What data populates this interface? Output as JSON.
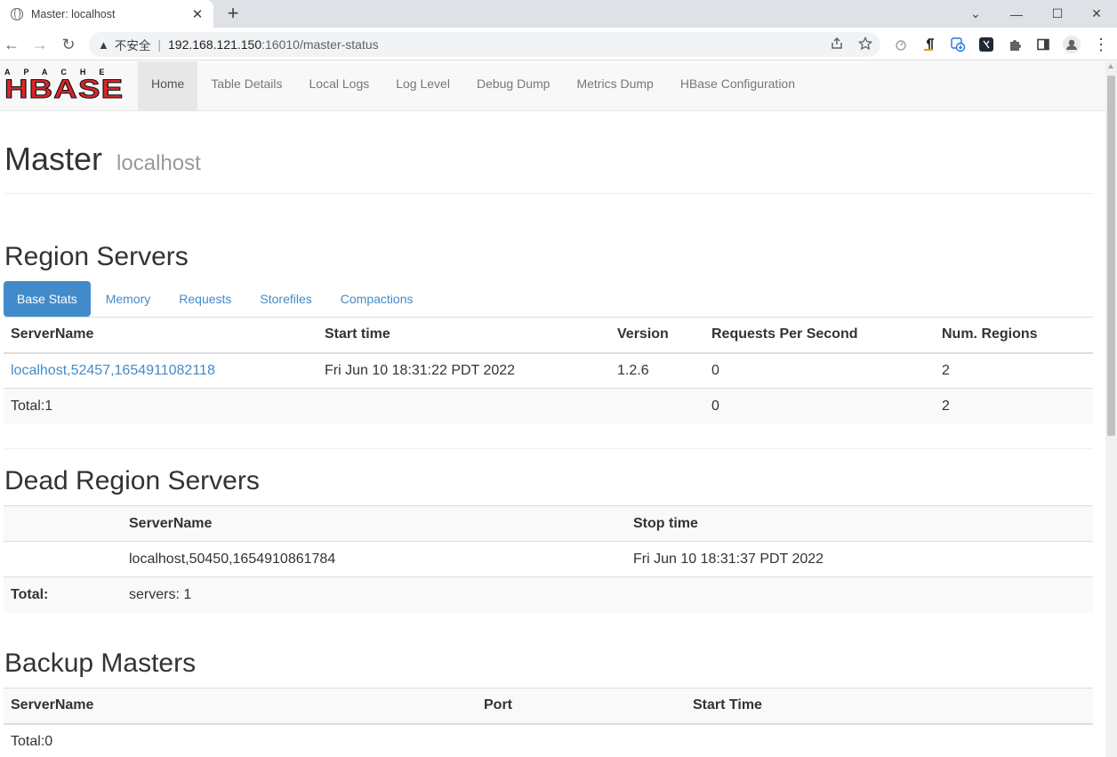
{
  "browser": {
    "tab_title": "Master: localhost",
    "close_glyph": "✕",
    "newtab_glyph": "+",
    "window_controls": [
      "⌄",
      "—",
      "☐",
      "✕"
    ],
    "nav": {
      "back": "←",
      "forward": "→",
      "reload": "↻"
    },
    "address": {
      "warning_glyph": "▲",
      "insecure_label": "不安全",
      "separator": "|",
      "host": "192.168.121.150",
      "path": ":16010/master-status"
    },
    "menu_glyph": "⋮"
  },
  "logo": {
    "top": "APACHE",
    "bottom": "HBASE"
  },
  "nav_items": [
    "Home",
    "Table Details",
    "Local Logs",
    "Log Level",
    "Debug Dump",
    "Metrics Dump",
    "HBase Configuration"
  ],
  "header": {
    "title": "Master",
    "subtitle": "localhost"
  },
  "region_servers": {
    "heading": "Region Servers",
    "tabs": [
      "Base Stats",
      "Memory",
      "Requests",
      "Storefiles",
      "Compactions"
    ],
    "columns": [
      "ServerName",
      "Start time",
      "Version",
      "Requests Per Second",
      "Num. Regions"
    ],
    "rows": [
      {
        "server": "localhost,52457,1654911082118",
        "start": "Fri Jun 10 18:31:22 PDT 2022",
        "version": "1.2.6",
        "rps": "0",
        "regions": "2"
      }
    ],
    "total": {
      "label": "Total:1",
      "rps": "0",
      "regions": "2"
    }
  },
  "dead_region_servers": {
    "heading": "Dead Region Servers",
    "columns": [
      "ServerName",
      "Stop time"
    ],
    "rows": [
      {
        "server": "localhost,50450,1654910861784",
        "stop": "Fri Jun 10 18:31:37 PDT 2022"
      }
    ],
    "total": {
      "label": "Total:",
      "value": "servers: 1"
    }
  },
  "backup_masters": {
    "heading": "Backup Masters",
    "columns": [
      "ServerName",
      "Port",
      "Start Time"
    ],
    "total": "Total:0"
  },
  "colors": {
    "link": "#428bca",
    "hbase_red": "#d8262c"
  }
}
